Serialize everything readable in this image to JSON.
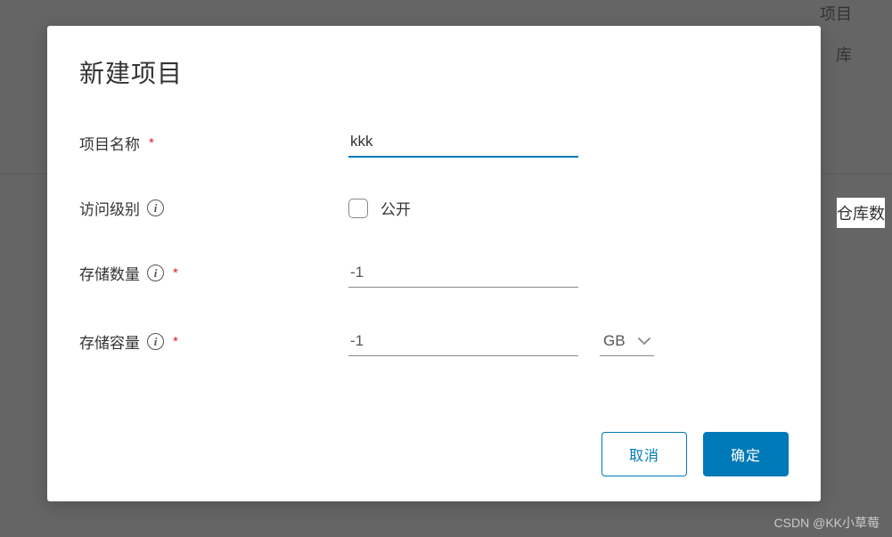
{
  "modal": {
    "title": "新建项目",
    "fields": {
      "project_name": {
        "label": "项目名称",
        "value": "kkk",
        "required_mark": "*"
      },
      "access_level": {
        "label": "访问级别",
        "checkbox_label": "公开",
        "checked": false
      },
      "storage_count": {
        "label": "存储数量",
        "value": "-1",
        "required_mark": "*"
      },
      "storage_capacity": {
        "label": "存储容量",
        "value": "-1",
        "unit": "GB",
        "required_mark": "*"
      }
    },
    "buttons": {
      "cancel": "取消",
      "confirm": "确定"
    }
  },
  "background": {
    "text1": "项目",
    "text2": "库",
    "text3": "仓库数"
  },
  "watermark": "CSDN @KK小草莓",
  "colors": {
    "primary": "#0079b8",
    "danger": "#e02020"
  }
}
